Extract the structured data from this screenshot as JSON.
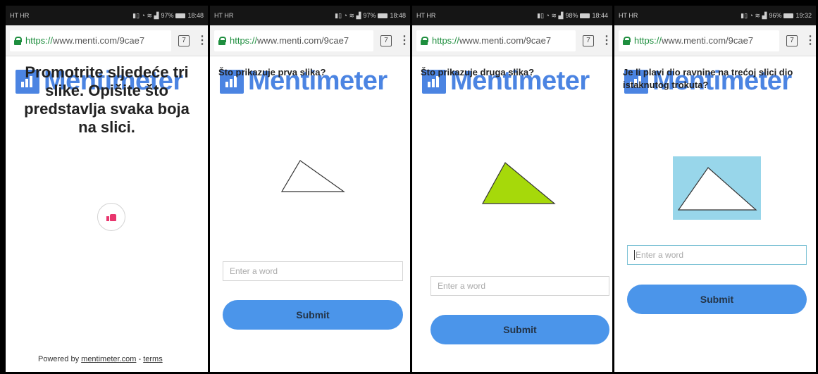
{
  "brand": {
    "name": "Mentimeter",
    "color": "#4b84e2"
  },
  "phones": [
    {
      "status": {
        "carrier": "HT HR",
        "battery": "97%",
        "time": "18:48"
      },
      "url": {
        "scheme": "https://",
        "rest": "www.menti.com/9cae7"
      },
      "tabs_count": "7",
      "question": "Promotrite sljedeće tri slike. Opišite što predstavlja svaka boja na slici.",
      "footer": {
        "powered_by": "Powered by",
        "link": "mentimeter.com",
        "separator": "-",
        "terms": "terms"
      }
    },
    {
      "status": {
        "carrier": "HT HR",
        "battery": "97%",
        "time": "18:48"
      },
      "url": {
        "scheme": "https://",
        "rest": "www.menti.com/9cae7"
      },
      "tabs_count": "7",
      "question": "Što prikazuje prva slika?",
      "input_placeholder": "Enter a word",
      "submit_label": "Submit"
    },
    {
      "status": {
        "carrier": "HT HR",
        "battery": "98%",
        "time": "18:44"
      },
      "url": {
        "scheme": "https://",
        "rest": "www.menti.com/9cae7"
      },
      "tabs_count": "7",
      "question": "Što prikazuje druga slika?",
      "input_placeholder": "Enter a word",
      "submit_label": "Submit"
    },
    {
      "status": {
        "carrier": "HT HR",
        "battery": "96%",
        "time": "19:32"
      },
      "url": {
        "scheme": "https://",
        "rest": "www.menti.com/9cae7"
      },
      "tabs_count": "7",
      "question": "Je li plavi dio ravnine na trećoj slici dio istaknutog trokuta?",
      "input_placeholder": "Enter a word",
      "submit_label": "Submit"
    }
  ],
  "colors": {
    "submit": "#4b95ea",
    "triangle_fill_green": "#a6d90a",
    "plane_blue": "#98d6ea",
    "thumb_icon": "#e8356d"
  }
}
